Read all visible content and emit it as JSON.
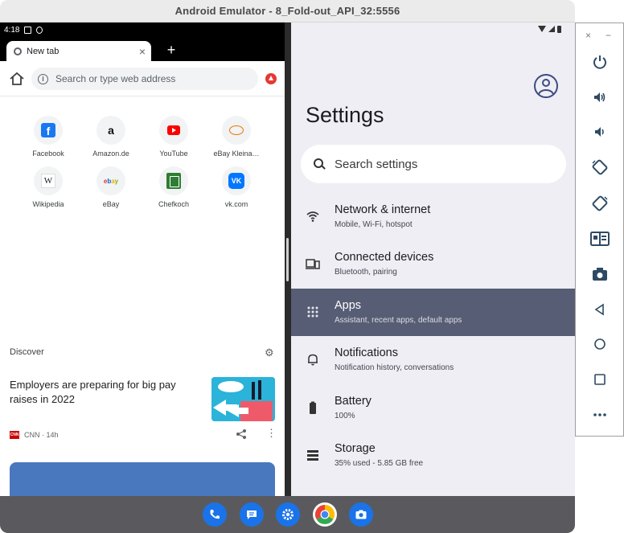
{
  "window": {
    "title": "Android Emulator - 8_Fold-out_API_32:5556"
  },
  "chrome": {
    "status_time": "4:18",
    "tab_label": "New tab",
    "tab_close": "×",
    "new_tab": "+",
    "omnibox_placeholder": "Search or type web address",
    "shortcuts": [
      {
        "label": "Facebook",
        "icon": "facebook-icon"
      },
      {
        "label": "Amazon.de",
        "icon": "amazon-icon"
      },
      {
        "label": "YouTube",
        "icon": "youtube-icon"
      },
      {
        "label": "eBay Kleina…",
        "icon": "ebay-kleinanzeigen-icon"
      },
      {
        "label": "Wikipedia",
        "icon": "wikipedia-icon"
      },
      {
        "label": "eBay",
        "icon": "ebay-icon"
      },
      {
        "label": "Chefkoch",
        "icon": "chefkoch-icon"
      },
      {
        "label": "vk.com",
        "icon": "vk-icon"
      }
    ],
    "discover_label": "Discover",
    "article": {
      "title": "Employers are preparing for big pay raises in 2022",
      "source": "CNN · 14h",
      "source_logo": "CNN"
    }
  },
  "settings": {
    "title": "Settings",
    "search_placeholder": "Search settings",
    "items": [
      {
        "title": "Network & internet",
        "subtitle": "Mobile, Wi-Fi, hotspot",
        "icon": "wifi-icon",
        "active": false
      },
      {
        "title": "Connected devices",
        "subtitle": "Bluetooth, pairing",
        "icon": "devices-icon",
        "active": false
      },
      {
        "title": "Apps",
        "subtitle": "Assistant, recent apps, default apps",
        "icon": "apps-grid-icon",
        "active": true
      },
      {
        "title": "Notifications",
        "subtitle": "Notification history, conversations",
        "icon": "bell-icon",
        "active": false
      },
      {
        "title": "Battery",
        "subtitle": "100%",
        "icon": "battery-icon",
        "active": false
      },
      {
        "title": "Storage",
        "subtitle": "35% used - 5.85 GB free",
        "icon": "storage-icon",
        "active": false
      }
    ]
  },
  "taskbar": {
    "apps": [
      "phone-icon",
      "messages-icon",
      "settings-icon",
      "chrome-icon",
      "camera-icon"
    ]
  },
  "emulator_controls": {
    "close": "×",
    "minimize": "−",
    "buttons": [
      "power-icon",
      "volume-up-icon",
      "volume-down-icon",
      "rotate-left-icon",
      "rotate-right-icon",
      "fold-icon",
      "camera-screenshot-icon",
      "back-icon",
      "home-icon",
      "overview-icon",
      "more-icon"
    ]
  },
  "colors": {
    "active_item_bg": "#575d74",
    "settings_bg": "#eeeef4",
    "taskbar_bg": "#5a5a5e"
  }
}
